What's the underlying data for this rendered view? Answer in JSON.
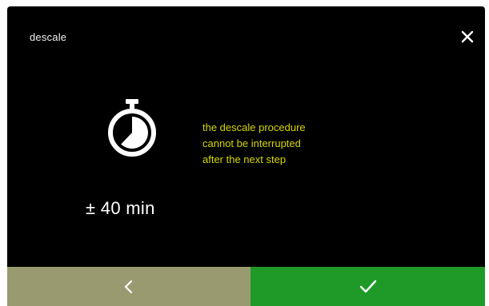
{
  "header": {
    "title": "descale",
    "close_icon": "close-icon"
  },
  "main": {
    "icon": "stopwatch-icon",
    "duration": "± 40 min",
    "message_lines": [
      "the descale procedure",
      "cannot be interrupted",
      "after the next step"
    ],
    "message_color": "#d6d600"
  },
  "footer": {
    "back_icon": "chevron-left-icon",
    "confirm_icon": "checkmark-icon",
    "back_color": "#9a9a70",
    "confirm_color": "#1f9a28"
  }
}
